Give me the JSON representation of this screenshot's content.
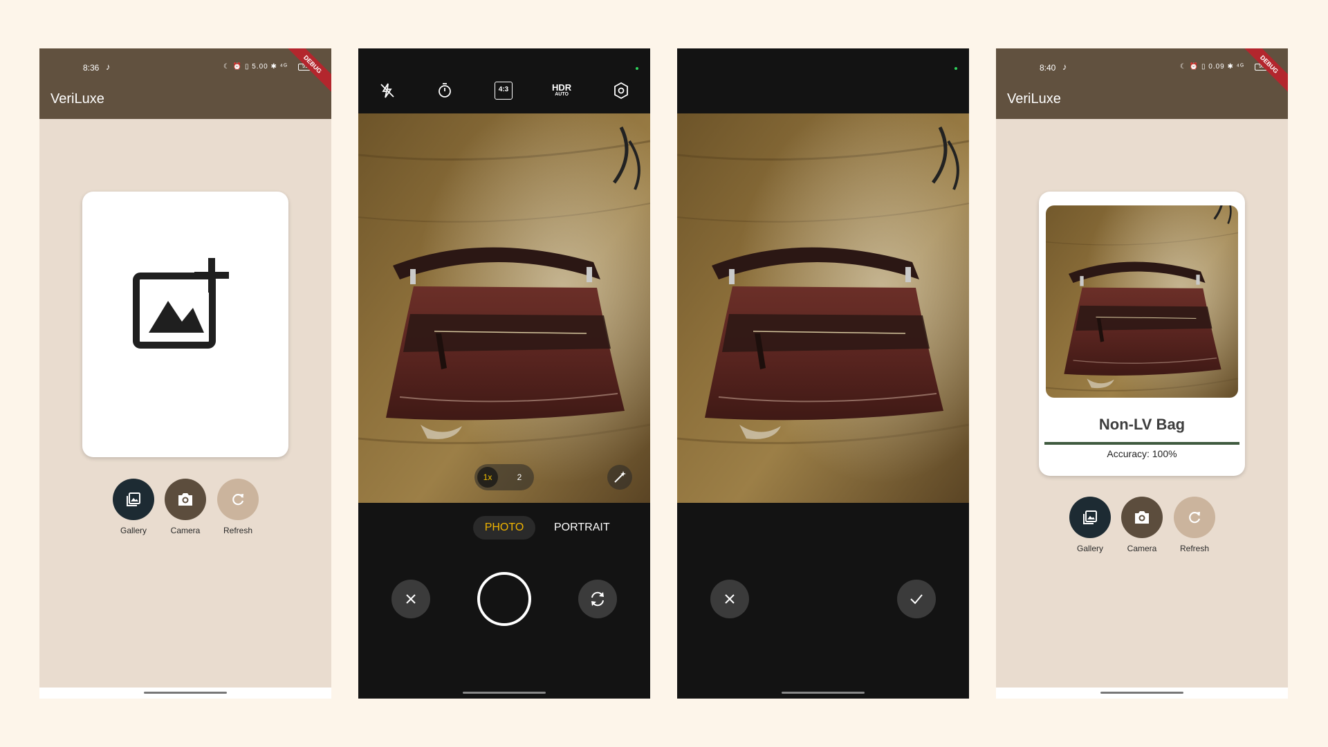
{
  "colors": {
    "page_background": "#fdf5ea",
    "app_bar": "#61513f",
    "app_background": "#e9dccf",
    "gallery_button": "#1d2b33",
    "camera_button": "#5c4d3d",
    "refresh_button": "#cbb49d",
    "accuracy_bar": "#3f5a3f",
    "camera_mode_active": "#f0b400",
    "debug_ribbon": "#b3262d"
  },
  "screen1": {
    "status_time": "8:36",
    "status_icons": "☾ ⏰ ▯ 5.00 ✱ ⁴ᴳ",
    "battery": "91",
    "debug": "DEBUG",
    "app_title": "VeriLuxe",
    "placeholder_icon": "add-photo-icon",
    "actions": {
      "gallery": "Gallery",
      "camera": "Camera",
      "refresh": "Refresh"
    }
  },
  "screen2": {
    "toolbar_icons": [
      "flash-off-icon",
      "timer-icon",
      "aspect-ratio-icon",
      "hdr-auto-icon",
      "settings-icon"
    ],
    "aspect_ratio": "4:3",
    "hdr_top": "HDR",
    "hdr_bottom": "AUTO",
    "zoom_levels": [
      "1x",
      "2"
    ],
    "modes": [
      "PHOTO",
      "PORTRAIT"
    ],
    "active_mode": "PHOTO",
    "buttons": [
      "close-icon",
      "shutter-button",
      "switch-camera-icon"
    ]
  },
  "screen3": {
    "buttons": [
      "close-icon",
      "check-icon"
    ]
  },
  "screen4": {
    "status_time": "8:40",
    "status_icons": "☾ ⏰ ▯ 0.09 ✱ ⁴ᴳ",
    "battery": "90",
    "debug": "DEBUG",
    "app_title": "VeriLuxe",
    "result_label": "Non-LV Bag",
    "accuracy_text": "Accuracy: 100%",
    "accuracy_value": 100,
    "actions": {
      "gallery": "Gallery",
      "camera": "Camera",
      "refresh": "Refresh"
    }
  }
}
